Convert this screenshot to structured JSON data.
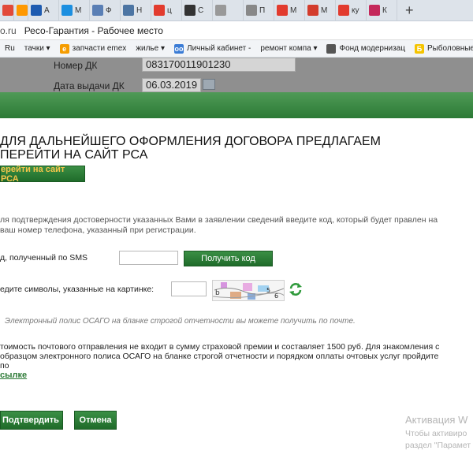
{
  "browser": {
    "tabs": [
      {
        "label": "",
        "color": "#e24a3a"
      },
      {
        "label": "",
        "color": "#ff9800"
      },
      {
        "label": "А",
        "color": "#1e5bb0"
      },
      {
        "label": "М",
        "color": "#1c8fe0"
      },
      {
        "label": "Ф",
        "color": "#5a7fb5"
      },
      {
        "label": "Н",
        "color": "#4c75a3"
      },
      {
        "label": "ц",
        "color": "#e23b2e"
      },
      {
        "label": "С",
        "color": "#333333"
      },
      {
        "label": "",
        "color": "#999999"
      },
      {
        "label": "П",
        "color": "#888888"
      },
      {
        "label": "М",
        "color": "#e23b2e"
      },
      {
        "label": "М",
        "color": "#d33c2c"
      },
      {
        "label": "ку",
        "color": "#e23b2e"
      },
      {
        "label": "К",
        "color": "#c4285a"
      }
    ],
    "new_tab_label": "+",
    "address_host": "o.ru",
    "page_title": "Ресо-Гарантия - Рабочее место",
    "bookmarks": [
      {
        "label": "Ru",
        "icon": ""
      },
      {
        "label": "тачки ▾",
        "icon": ""
      },
      {
        "label": "запчасти emex",
        "icon": "e",
        "color": "#f59c00"
      },
      {
        "label": "жилье ▾",
        "icon": ""
      },
      {
        "label": "Личный кабинет -",
        "icon": "oo",
        "color": "#3a7bd5"
      },
      {
        "label": "ремонт компа ▾",
        "icon": ""
      },
      {
        "label": "Фонд модернизац",
        "icon": "",
        "color": "#555555"
      },
      {
        "label": "Рыболовные",
        "icon": "Б",
        "color": "#f5c400"
      }
    ]
  },
  "backdrop": {
    "dk_number_label": "Номер ДК",
    "dk_number_value": "083170011901230",
    "dk_date_label": "Дата выдачи ДК",
    "dk_date_value": "06.03.2019"
  },
  "modal": {
    "heading": "для дальнейшего оформления договора предлагаем перейти на сайт РСА",
    "go_rsa_button": "ерейти на сайт РСА",
    "description": "ля подтверждения достоверности указанных Вами в заявлении сведений введите код, который будет правлен на ваш номер телефона, указанный при регистрации.",
    "sms_label": "д, полученный по SMS",
    "sms_value": "",
    "get_code_button": "Получить код",
    "captcha_label": "едите символы, указанные на картинке:",
    "captcha_value": "",
    "note": "Электронный полис ОСАГО на бланке строгой отчетности вы можете получить по почте.",
    "info": "тоимость почтового отправления не входит в сумму страховой премии и составляет 1500 руб. Для знакомления с образцом электронного полиса ОСАГО на бланке строгой отчетности и порядком оплаты очтовых услуг пройдите по",
    "link": "сылке",
    "confirm_button": "Подтвердить",
    "cancel_button": "Отмена"
  },
  "watermark": {
    "line1": "Активация W",
    "line2": "Чтобы активиро",
    "line3": "раздел \"Парамет"
  },
  "colors": {
    "header_green": "#2c7a36",
    "button_green": "#1f6b2a",
    "backdrop_gray": "#8f8f8f"
  }
}
